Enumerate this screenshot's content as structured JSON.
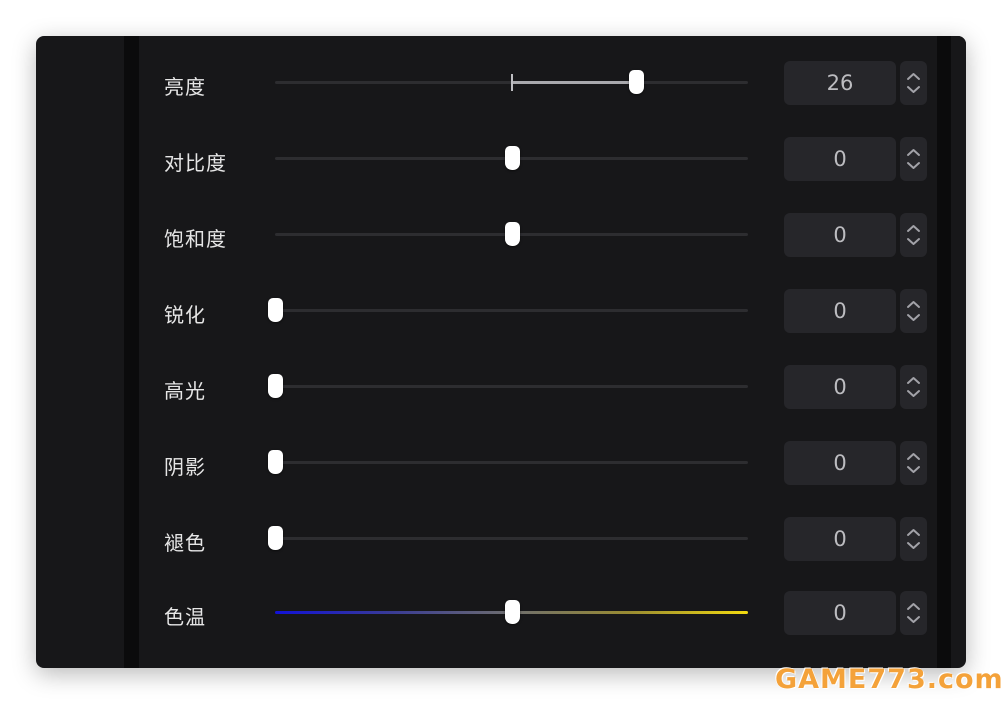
{
  "sliders": [
    {
      "label": "亮度",
      "value": "26",
      "fraction": 0.764,
      "center_origin": true
    },
    {
      "label": "对比度",
      "value": "0",
      "fraction": 0.5,
      "center_origin": true
    },
    {
      "label": "饱和度",
      "value": "0",
      "fraction": 0.5,
      "center_origin": true
    },
    {
      "label": "锐化",
      "value": "0",
      "fraction": 0.0,
      "center_origin": false
    },
    {
      "label": "高光",
      "value": "0",
      "fraction": 0.0,
      "center_origin": false
    },
    {
      "label": "阴影",
      "value": "0",
      "fraction": 0.0,
      "center_origin": false
    },
    {
      "label": "褪色",
      "value": "0",
      "fraction": 0.0,
      "center_origin": false
    },
    {
      "label": "色温",
      "value": "0",
      "fraction": 0.5,
      "center_origin": true,
      "gradient": true
    }
  ],
  "icons": {
    "stepper": "chevron-up-down-icon"
  },
  "colors": {
    "panel": "#171719",
    "input": "#26262a",
    "knob": "#ffffff",
    "temp_cold": "#1212d8",
    "temp_warm": "#f2da10"
  },
  "watermark": {
    "text": "GAME773.com"
  }
}
